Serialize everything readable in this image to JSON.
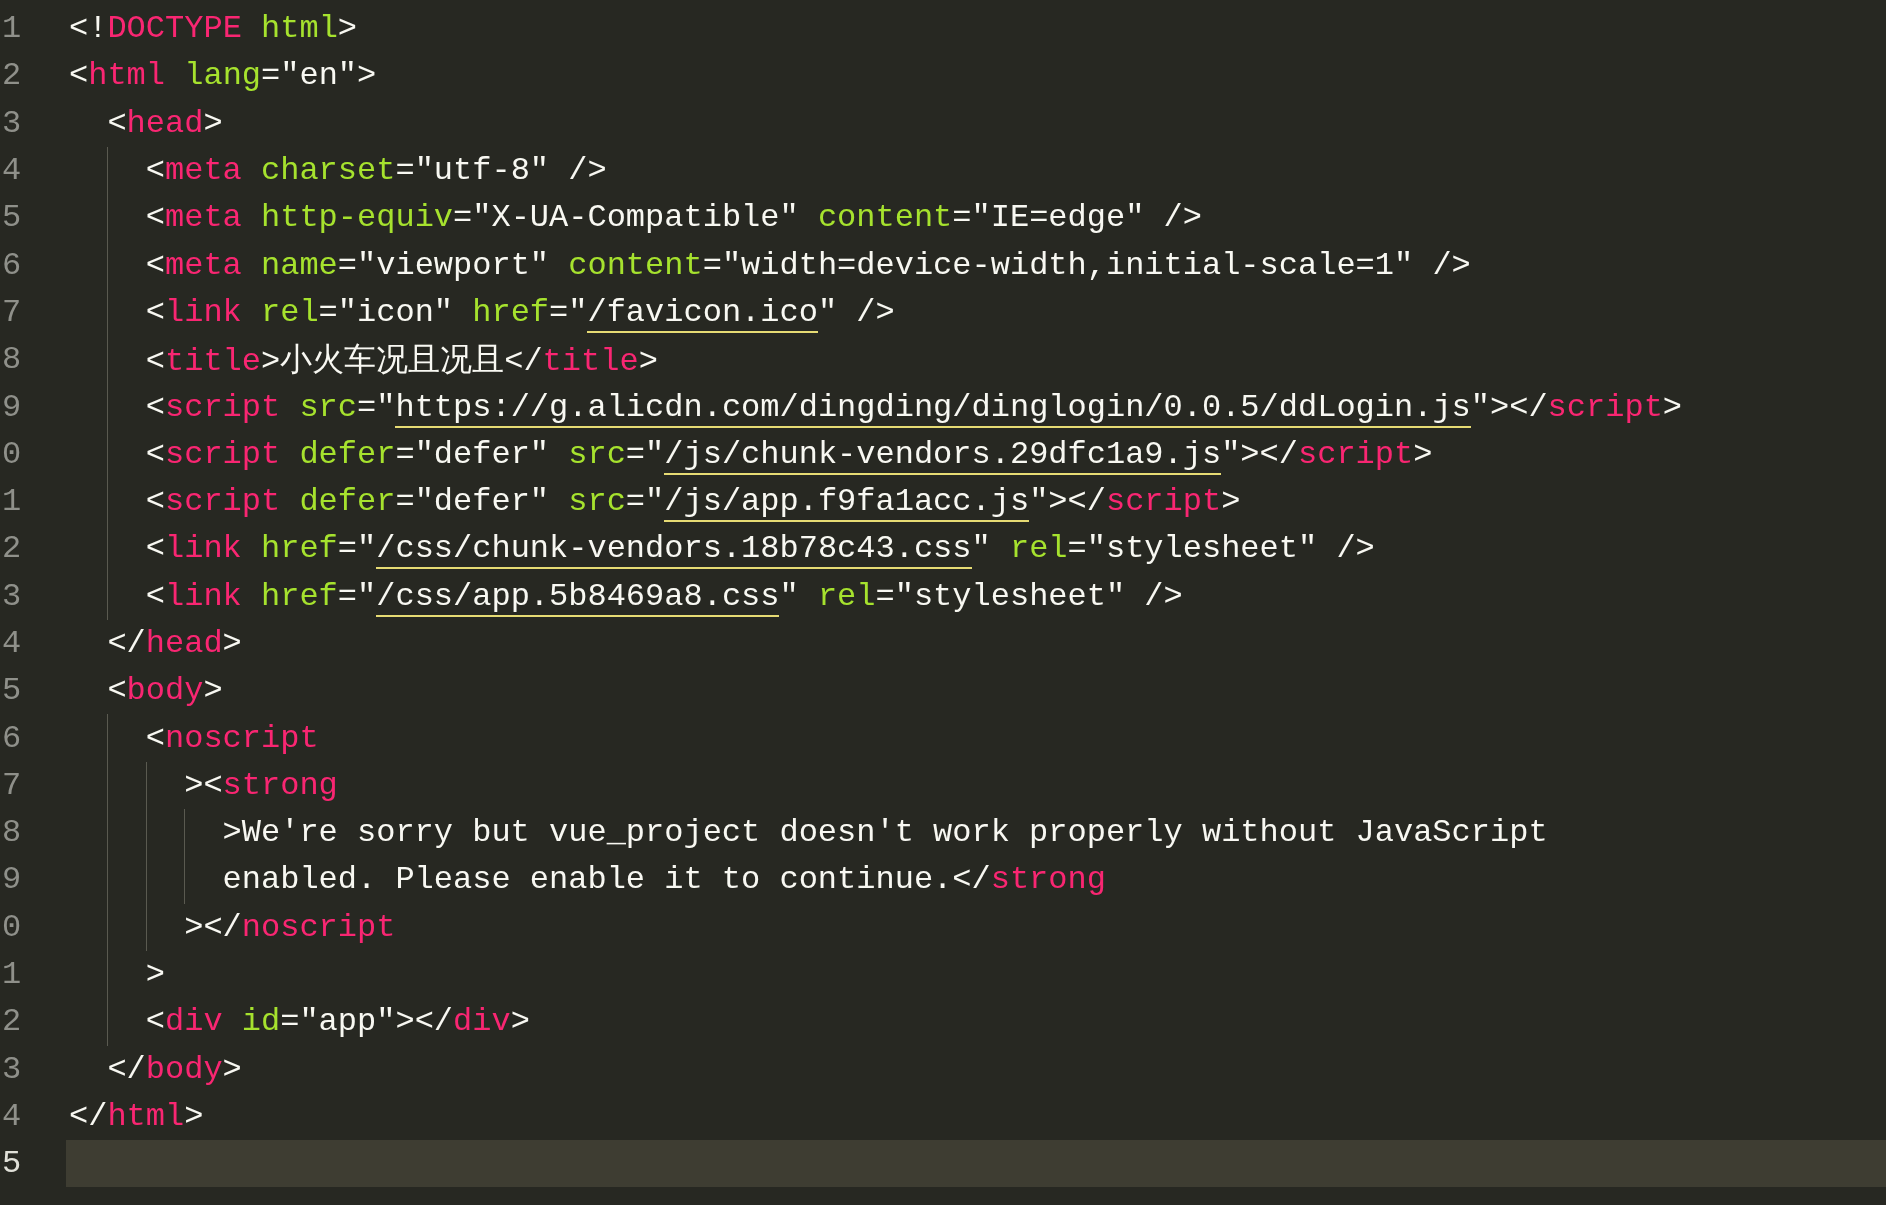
{
  "lines": [
    {
      "number": "1",
      "selected": false,
      "tokens": [
        {
          "kind": "p",
          "text": "<!"
        },
        {
          "kind": "tag",
          "text": "DOCTYPE "
        },
        {
          "kind": "attr",
          "text": "html"
        },
        {
          "kind": "p",
          "text": ">"
        }
      ]
    },
    {
      "number": "2",
      "selected": false,
      "tokens": [
        {
          "kind": "p",
          "text": "<"
        },
        {
          "kind": "tag",
          "text": "html "
        },
        {
          "kind": "attr",
          "text": "lang"
        },
        {
          "kind": "p",
          "text": "=\"en\">"
        }
      ],
      "children": [
        {
          "number": "3",
          "selected": false,
          "tokens": [
            {
              "kind": "p",
              "text": "<"
            },
            {
              "kind": "tag",
              "text": "head"
            },
            {
              "kind": "p",
              "text": ">"
            }
          ],
          "children": [
            {
              "number": "4",
              "selected": false,
              "tokens": [
                {
                  "kind": "p",
                  "text": "<"
                },
                {
                  "kind": "tag",
                  "text": "meta "
                },
                {
                  "kind": "attr",
                  "text": "charset"
                },
                {
                  "kind": "p",
                  "text": "=\"utf-8\" />"
                }
              ]
            },
            {
              "number": "5",
              "selected": false,
              "tokens": [
                {
                  "kind": "p",
                  "text": "<"
                },
                {
                  "kind": "tag",
                  "text": "meta "
                },
                {
                  "kind": "attr",
                  "text": "http-equiv"
                },
                {
                  "kind": "p",
                  "text": "=\"X-UA-Compatible\" "
                },
                {
                  "kind": "attr",
                  "text": "content"
                },
                {
                  "kind": "p",
                  "text": "=\"IE=edge\" />"
                }
              ]
            },
            {
              "number": "6",
              "selected": false,
              "tokens": [
                {
                  "kind": "p",
                  "text": "<"
                },
                {
                  "kind": "tag",
                  "text": "meta "
                },
                {
                  "kind": "attr",
                  "text": "name"
                },
                {
                  "kind": "p",
                  "text": "=\"viewport\" "
                },
                {
                  "kind": "attr",
                  "text": "content"
                },
                {
                  "kind": "p",
                  "text": "=\"width=device-width,initial-scale=1\" />"
                }
              ]
            },
            {
              "number": "7",
              "selected": false,
              "tokens": [
                {
                  "kind": "p",
                  "text": "<"
                },
                {
                  "kind": "tag",
                  "text": "link "
                },
                {
                  "kind": "attr",
                  "text": "rel"
                },
                {
                  "kind": "p",
                  "text": "=\"icon\" "
                },
                {
                  "kind": "attr",
                  "text": "href"
                },
                {
                  "kind": "p",
                  "text": "=\""
                },
                {
                  "kind": "url",
                  "text": "/favicon.ico"
                },
                {
                  "kind": "p",
                  "text": "\" />"
                }
              ]
            },
            {
              "number": "8",
              "selected": false,
              "tokens": [
                {
                  "kind": "p",
                  "text": "<"
                },
                {
                  "kind": "tag",
                  "text": "title"
                },
                {
                  "kind": "p",
                  "text": ">"
                },
                {
                  "kind": "cjk",
                  "text": "小火车况且况且"
                },
                {
                  "kind": "p",
                  "text": "</"
                },
                {
                  "kind": "tag",
                  "text": "title"
                },
                {
                  "kind": "p",
                  "text": ">"
                }
              ]
            },
            {
              "number": "9",
              "selected": false,
              "tokens": [
                {
                  "kind": "p",
                  "text": "<"
                },
                {
                  "kind": "tag",
                  "text": "script "
                },
                {
                  "kind": "attr",
                  "text": "src"
                },
                {
                  "kind": "p",
                  "text": "=\""
                },
                {
                  "kind": "url",
                  "text": "https://g.alicdn.com/dingding/dinglogin/0.0.5/ddLogin.js"
                },
                {
                  "kind": "p",
                  "text": "\"></"
                },
                {
                  "kind": "tag",
                  "text": "script"
                },
                {
                  "kind": "p",
                  "text": ">"
                }
              ]
            },
            {
              "number": "0",
              "selected": false,
              "tokens": [
                {
                  "kind": "p",
                  "text": "<"
                },
                {
                  "kind": "tag",
                  "text": "script "
                },
                {
                  "kind": "attr",
                  "text": "defer"
                },
                {
                  "kind": "p",
                  "text": "=\"defer\" "
                },
                {
                  "kind": "attr",
                  "text": "src"
                },
                {
                  "kind": "p",
                  "text": "=\""
                },
                {
                  "kind": "url",
                  "text": "/js/chunk-vendors.29dfc1a9.js"
                },
                {
                  "kind": "p",
                  "text": "\"></"
                },
                {
                  "kind": "tag",
                  "text": "script"
                },
                {
                  "kind": "p",
                  "text": ">"
                }
              ]
            },
            {
              "number": "1",
              "selected": false,
              "tokens": [
                {
                  "kind": "p",
                  "text": "<"
                },
                {
                  "kind": "tag",
                  "text": "script "
                },
                {
                  "kind": "attr",
                  "text": "defer"
                },
                {
                  "kind": "p",
                  "text": "=\"defer\" "
                },
                {
                  "kind": "attr",
                  "text": "src"
                },
                {
                  "kind": "p",
                  "text": "=\""
                },
                {
                  "kind": "url",
                  "text": "/js/app.f9fa1acc.js"
                },
                {
                  "kind": "p",
                  "text": "\"></"
                },
                {
                  "kind": "tag",
                  "text": "script"
                },
                {
                  "kind": "p",
                  "text": ">"
                }
              ]
            },
            {
              "number": "2",
              "selected": false,
              "tokens": [
                {
                  "kind": "p",
                  "text": "<"
                },
                {
                  "kind": "tag",
                  "text": "link "
                },
                {
                  "kind": "attr",
                  "text": "href"
                },
                {
                  "kind": "p",
                  "text": "=\""
                },
                {
                  "kind": "url",
                  "text": "/css/chunk-vendors.18b78c43.css"
                },
                {
                  "kind": "p",
                  "text": "\" "
                },
                {
                  "kind": "attr",
                  "text": "rel"
                },
                {
                  "kind": "p",
                  "text": "=\"stylesheet\" />"
                }
              ]
            },
            {
              "number": "3",
              "selected": false,
              "tokens": [
                {
                  "kind": "p",
                  "text": "<"
                },
                {
                  "kind": "tag",
                  "text": "link "
                },
                {
                  "kind": "attr",
                  "text": "href"
                },
                {
                  "kind": "p",
                  "text": "=\""
                },
                {
                  "kind": "url",
                  "text": "/css/app.5b8469a8.css"
                },
                {
                  "kind": "p",
                  "text": "\" "
                },
                {
                  "kind": "attr",
                  "text": "rel"
                },
                {
                  "kind": "p",
                  "text": "=\"stylesheet\" />"
                }
              ]
            }
          ]
        },
        {
          "number": "4",
          "selected": false,
          "tokens": [
            {
              "kind": "p",
              "text": "</"
            },
            {
              "kind": "tag",
              "text": "head"
            },
            {
              "kind": "p",
              "text": ">"
            }
          ]
        },
        {
          "number": "5",
          "selected": false,
          "tokens": [
            {
              "kind": "p",
              "text": "<"
            },
            {
              "kind": "tag",
              "text": "body"
            },
            {
              "kind": "p",
              "text": ">"
            }
          ],
          "children": [
            {
              "number": "6",
              "selected": false,
              "tokens": [
                {
                  "kind": "p",
                  "text": "<"
                },
                {
                  "kind": "tag",
                  "text": "noscript"
                }
              ],
              "children": [
                {
                  "number": "7",
                  "selected": false,
                  "tokens": [
                    {
                      "kind": "p",
                      "text": "><"
                    },
                    {
                      "kind": "tag",
                      "text": "strong"
                    }
                  ],
                  "children": [
                    {
                      "number": "8",
                      "selected": false,
                      "tokens": [
                        {
                          "kind": "p",
                          "text": ">We're sorry but vue_project doesn't work properly without JavaScript"
                        }
                      ]
                    },
                    {
                      "number": "9",
                      "selected": false,
                      "tokens": [
                        {
                          "kind": "p",
                          "text": "enabled. Please enable it to continue.</"
                        },
                        {
                          "kind": "tag",
                          "text": "strong"
                        }
                      ]
                    }
                  ]
                },
                {
                  "number": "0",
                  "selected": false,
                  "tokens": [
                    {
                      "kind": "p",
                      "text": "></"
                    },
                    {
                      "kind": "tag",
                      "text": "noscript"
                    }
                  ]
                }
              ]
            },
            {
              "number": "1",
              "selected": false,
              "tokens": [
                {
                  "kind": "p",
                  "text": ">"
                }
              ]
            },
            {
              "number": "2",
              "selected": false,
              "tokens": [
                {
                  "kind": "p",
                  "text": "<"
                },
                {
                  "kind": "tag",
                  "text": "div "
                },
                {
                  "kind": "attr",
                  "text": "id"
                },
                {
                  "kind": "p",
                  "text": "=\"app\"></"
                },
                {
                  "kind": "tag",
                  "text": "div"
                },
                {
                  "kind": "p",
                  "text": ">"
                }
              ]
            }
          ]
        },
        {
          "number": "3",
          "selected": false,
          "tokens": [
            {
              "kind": "p",
              "text": "</"
            },
            {
              "kind": "tag",
              "text": "body"
            },
            {
              "kind": "p",
              "text": ">"
            }
          ]
        }
      ]
    },
    {
      "number": "4",
      "selected": false,
      "tokens": [
        {
          "kind": "p",
          "text": "</"
        },
        {
          "kind": "tag",
          "text": "html"
        },
        {
          "kind": "p",
          "text": ">"
        }
      ]
    },
    {
      "number": "5",
      "selected": true
    }
  ]
}
